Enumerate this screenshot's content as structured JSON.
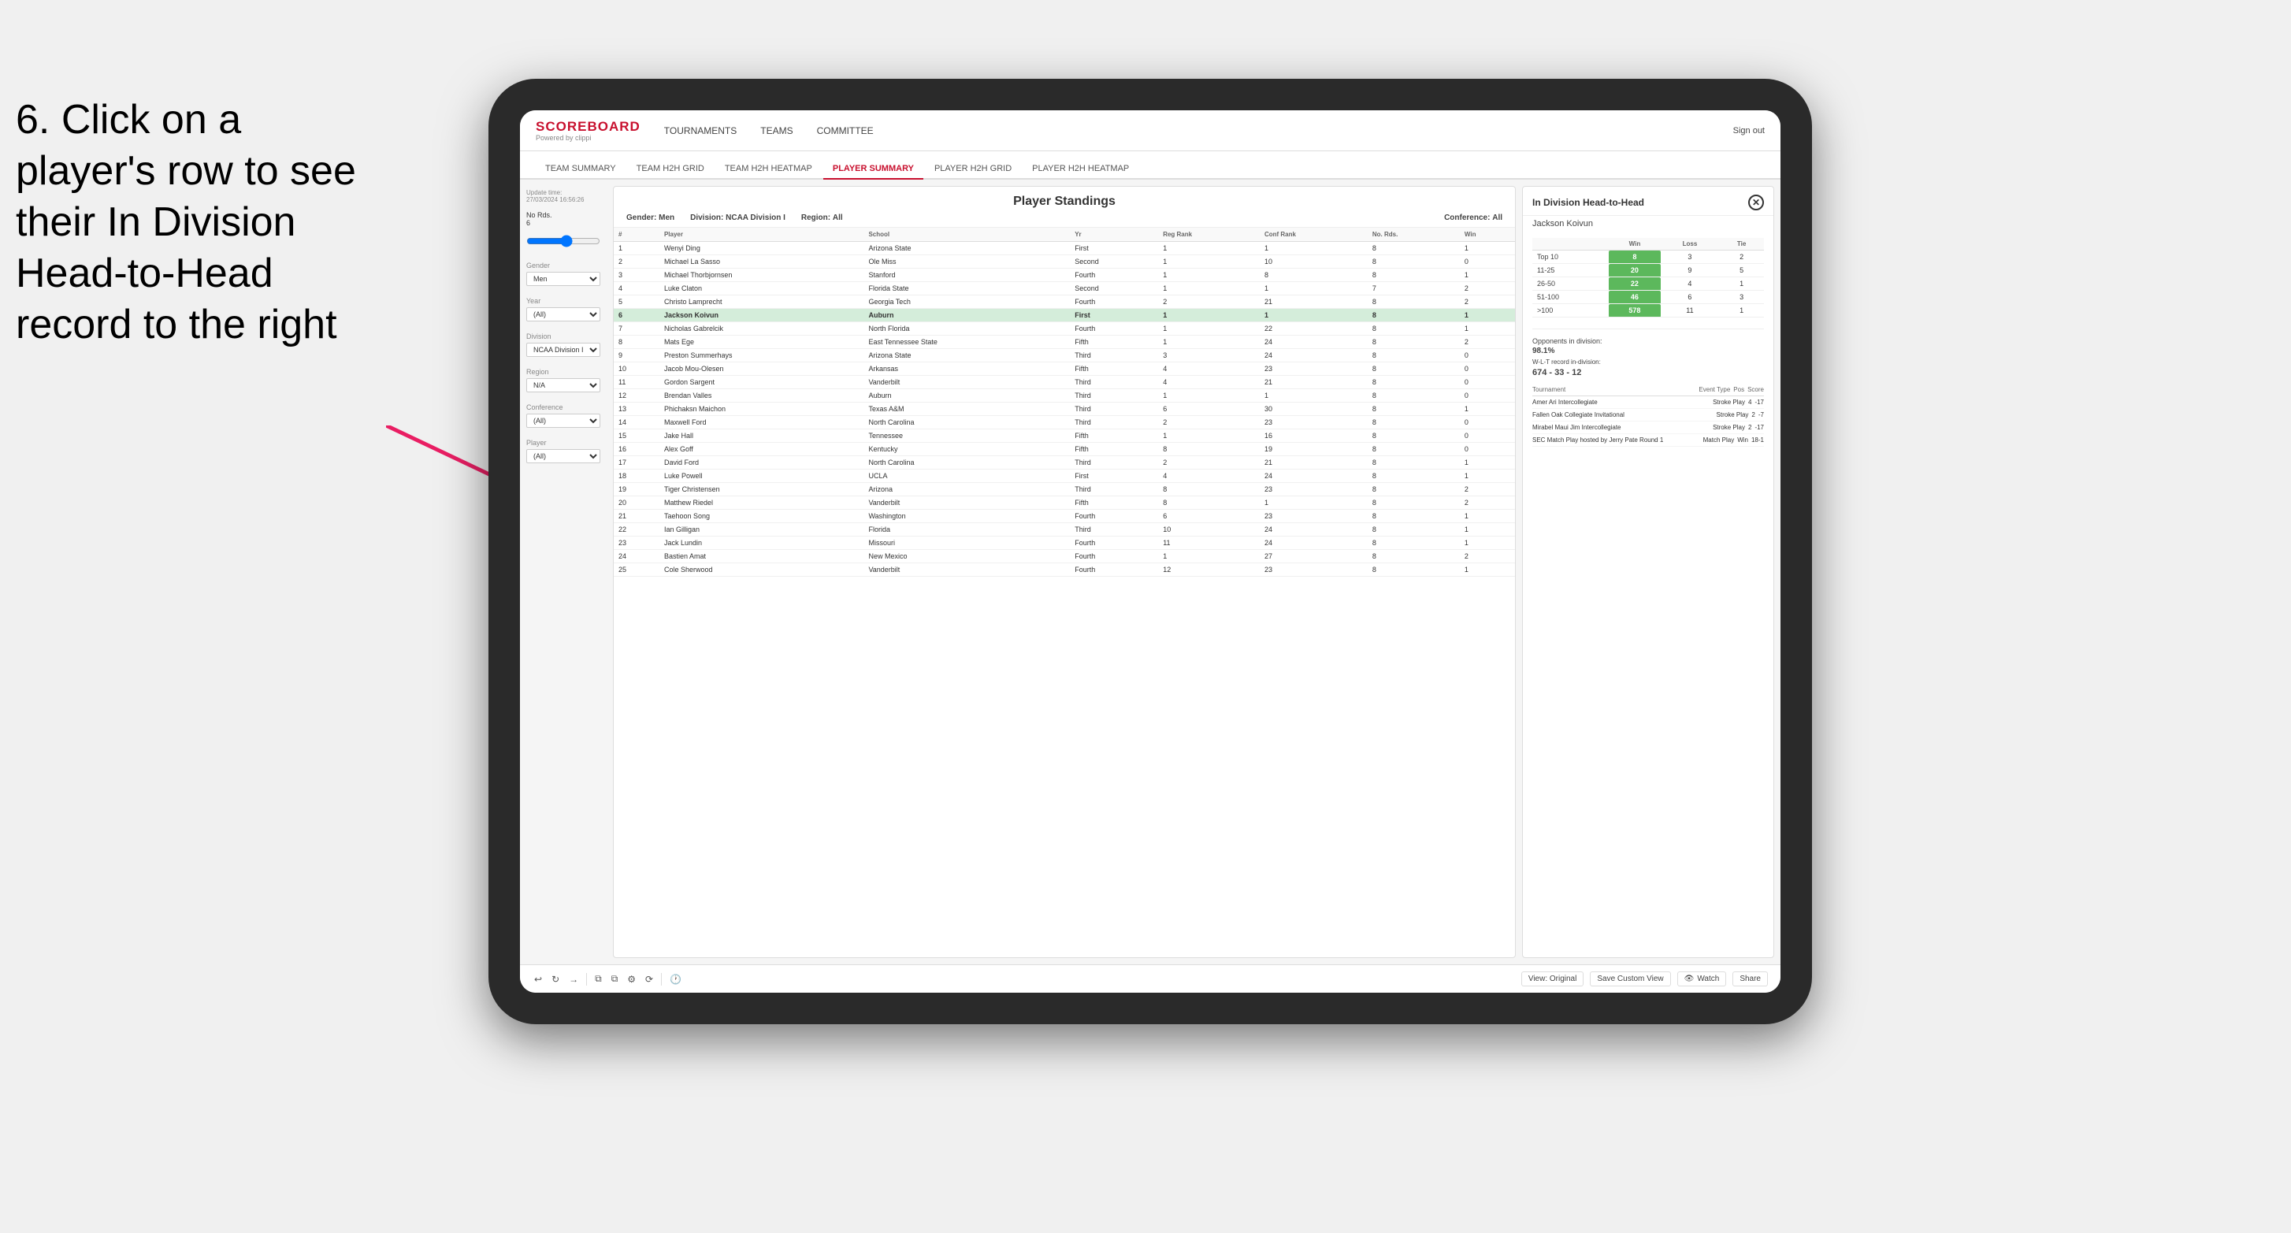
{
  "instruction": {
    "line1": "6. Click on a",
    "line2": "player's row to see",
    "line3": "their In Division",
    "line4": "Head-to-Head",
    "line5": "record to the right"
  },
  "nav": {
    "logo_title": "SCOREBOARD",
    "logo_sub": "Powered by clippi",
    "items": [
      "TOURNAMENTS",
      "TEAMS",
      "COMMITTEE"
    ],
    "sign_out": "Sign out"
  },
  "sub_nav": {
    "items": [
      "TEAM SUMMARY",
      "TEAM H2H GRID",
      "TEAM H2H HEATMAP",
      "PLAYER SUMMARY",
      "PLAYER H2H GRID",
      "PLAYER H2H HEATMAP"
    ],
    "active": "PLAYER SUMMARY"
  },
  "sidebar": {
    "update_label": "Update time:",
    "update_time": "27/03/2024 16:56:26",
    "rounds_label": "No Rds.",
    "rounds_value": "6",
    "gender_label": "Gender",
    "gender_value": "Men",
    "year_label": "Year",
    "year_value": "(All)",
    "division_label": "Division",
    "division_value": "NCAA Division I",
    "region_label": "Region",
    "region_value": "N/A",
    "conference_label": "Conference",
    "conference_value": "(All)",
    "player_label": "Player",
    "player_value": "(All)"
  },
  "standings": {
    "title": "Player Standings",
    "gender_label": "Gender:",
    "gender_value": "Men",
    "division_label": "Division:",
    "division_value": "NCAA Division I",
    "region_label": "Region:",
    "region_value": "All",
    "conference_label": "Conference:",
    "conference_value": "All",
    "columns": [
      "#",
      "Player",
      "School",
      "Yr",
      "Reg Rank",
      "Conf Rank",
      "No. Rds.",
      "Win"
    ],
    "rows": [
      {
        "num": "1",
        "player": "Wenyi Ding",
        "school": "Arizona State",
        "yr": "First",
        "reg": "1",
        "conf": "1",
        "rds": "8",
        "win": "1"
      },
      {
        "num": "2",
        "player": "Michael La Sasso",
        "school": "Ole Miss",
        "yr": "Second",
        "reg": "1",
        "conf": "10",
        "rds": "8",
        "win": "0"
      },
      {
        "num": "3",
        "player": "Michael Thorbjornsen",
        "school": "Stanford",
        "yr": "Fourth",
        "reg": "1",
        "conf": "8",
        "rds": "8",
        "win": "1"
      },
      {
        "num": "4",
        "player": "Luke Claton",
        "school": "Florida State",
        "yr": "Second",
        "reg": "1",
        "conf": "1",
        "rds": "7",
        "win": "2"
      },
      {
        "num": "5",
        "player": "Christo Lamprecht",
        "school": "Georgia Tech",
        "yr": "Fourth",
        "reg": "2",
        "conf": "21",
        "rds": "8",
        "win": "2"
      },
      {
        "num": "6",
        "player": "Jackson Koivun",
        "school": "Auburn",
        "yr": "First",
        "reg": "1",
        "conf": "1",
        "rds": "8",
        "win": "1",
        "selected": true
      },
      {
        "num": "7",
        "player": "Nicholas Gabrelcik",
        "school": "North Florida",
        "yr": "Fourth",
        "reg": "1",
        "conf": "22",
        "rds": "8",
        "win": "1"
      },
      {
        "num": "8",
        "player": "Mats Ege",
        "school": "East Tennessee State",
        "yr": "Fifth",
        "reg": "1",
        "conf": "24",
        "rds": "8",
        "win": "2"
      },
      {
        "num": "9",
        "player": "Preston Summerhays",
        "school": "Arizona State",
        "yr": "Third",
        "reg": "3",
        "conf": "24",
        "rds": "8",
        "win": "0"
      },
      {
        "num": "10",
        "player": "Jacob Mou-Olesen",
        "school": "Arkansas",
        "yr": "Fifth",
        "reg": "4",
        "conf": "23",
        "rds": "8",
        "win": "0"
      },
      {
        "num": "11",
        "player": "Gordon Sargent",
        "school": "Vanderbilt",
        "yr": "Third",
        "reg": "4",
        "conf": "21",
        "rds": "8",
        "win": "0"
      },
      {
        "num": "12",
        "player": "Brendan Valles",
        "school": "Auburn",
        "yr": "Third",
        "reg": "1",
        "conf": "1",
        "rds": "8",
        "win": "0"
      },
      {
        "num": "13",
        "player": "Phichaksn Maichon",
        "school": "Texas A&M",
        "yr": "Third",
        "reg": "6",
        "conf": "30",
        "rds": "8",
        "win": "1"
      },
      {
        "num": "14",
        "player": "Maxwell Ford",
        "school": "North Carolina",
        "yr": "Third",
        "reg": "2",
        "conf": "23",
        "rds": "8",
        "win": "0"
      },
      {
        "num": "15",
        "player": "Jake Hall",
        "school": "Tennessee",
        "yr": "Fifth",
        "reg": "1",
        "conf": "16",
        "rds": "8",
        "win": "0"
      },
      {
        "num": "16",
        "player": "Alex Goff",
        "school": "Kentucky",
        "yr": "Fifth",
        "reg": "8",
        "conf": "19",
        "rds": "8",
        "win": "0"
      },
      {
        "num": "17",
        "player": "David Ford",
        "school": "North Carolina",
        "yr": "Third",
        "reg": "2",
        "conf": "21",
        "rds": "8",
        "win": "1"
      },
      {
        "num": "18",
        "player": "Luke Powell",
        "school": "UCLA",
        "yr": "First",
        "reg": "4",
        "conf": "24",
        "rds": "8",
        "win": "1"
      },
      {
        "num": "19",
        "player": "Tiger Christensen",
        "school": "Arizona",
        "yr": "Third",
        "reg": "8",
        "conf": "23",
        "rds": "8",
        "win": "2"
      },
      {
        "num": "20",
        "player": "Matthew Riedel",
        "school": "Vanderbilt",
        "yr": "Fifth",
        "reg": "8",
        "conf": "1",
        "rds": "8",
        "win": "2"
      },
      {
        "num": "21",
        "player": "Taehoon Song",
        "school": "Washington",
        "yr": "Fourth",
        "reg": "6",
        "conf": "23",
        "rds": "8",
        "win": "1"
      },
      {
        "num": "22",
        "player": "Ian Gilligan",
        "school": "Florida",
        "yr": "Third",
        "reg": "10",
        "conf": "24",
        "rds": "8",
        "win": "1"
      },
      {
        "num": "23",
        "player": "Jack Lundin",
        "school": "Missouri",
        "yr": "Fourth",
        "reg": "11",
        "conf": "24",
        "rds": "8",
        "win": "1"
      },
      {
        "num": "24",
        "player": "Bastien Amat",
        "school": "New Mexico",
        "yr": "Fourth",
        "reg": "1",
        "conf": "27",
        "rds": "8",
        "win": "2"
      },
      {
        "num": "25",
        "player": "Cole Sherwood",
        "school": "Vanderbilt",
        "yr": "Fourth",
        "reg": "12",
        "conf": "23",
        "rds": "8",
        "win": "1"
      }
    ]
  },
  "h2h": {
    "title": "In Division Head-to-Head",
    "player_name": "Jackson Koivun",
    "columns": [
      "",
      "Win",
      "Loss",
      "Tie"
    ],
    "rows": [
      {
        "range": "Top 10",
        "win": "8",
        "loss": "3",
        "tie": "2"
      },
      {
        "range": "11-25",
        "win": "20",
        "loss": "9",
        "tie": "5"
      },
      {
        "range": "26-50",
        "win": "22",
        "loss": "4",
        "tie": "1"
      },
      {
        "range": "51-100",
        "win": "46",
        "loss": "6",
        "tie": "3"
      },
      {
        "range": ">100",
        "win": "578",
        "loss": "11",
        "tie": "1"
      }
    ],
    "opponents_label": "Opponents in division:",
    "opponents_pct": "98.1%",
    "wl_label": "W-L-T record in-division:",
    "wl_record": "674 - 33 - 12",
    "tournament_columns": [
      "Tournament",
      "Event Type",
      "Pos",
      "Score"
    ],
    "tournaments": [
      {
        "name": "Amer Ari Intercollegiate",
        "type": "Stroke Play",
        "pos": "4",
        "score": "-17"
      },
      {
        "name": "Fallen Oak Collegiate Invitational",
        "type": "Stroke Play",
        "pos": "2",
        "score": "-7"
      },
      {
        "name": "Mirabel Maui Jim Intercollegiate",
        "type": "Stroke Play",
        "pos": "2",
        "score": "-17"
      },
      {
        "name": "SEC Match Play hosted by Jerry Pate Round 1",
        "type": "Match Play",
        "pos": "Win",
        "score": "18-1"
      }
    ]
  },
  "toolbar": {
    "view_original": "View: Original",
    "save_custom": "Save Custom View",
    "watch": "Watch",
    "share": "Share"
  },
  "colors": {
    "accent_red": "#c8102e",
    "win_green": "#5cb85c",
    "selected_row": "#d4edda"
  }
}
